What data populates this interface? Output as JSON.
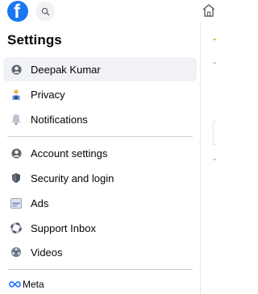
{
  "header": {
    "logo_icon": "facebook-logo-icon",
    "logo_text": "f",
    "search_icon": "search-icon",
    "home_icon": "home-icon"
  },
  "sidebar": {
    "title": "Settings",
    "profile_items": [
      {
        "label": "Deepak Kumar",
        "icon": "profile-icon",
        "active": true
      },
      {
        "label": "Privacy",
        "icon": "lock-person-icon",
        "active": false
      },
      {
        "label": "Notifications",
        "icon": "bell-icon",
        "active": false
      }
    ],
    "settings_items": [
      {
        "label": "Account settings",
        "icon": "account-icon"
      },
      {
        "label": "Security and login",
        "icon": "shield-icon"
      },
      {
        "label": "Ads",
        "icon": "ads-icon"
      },
      {
        "label": "Support Inbox",
        "icon": "lifebuoy-icon"
      },
      {
        "label": "Videos",
        "icon": "film-icon"
      }
    ],
    "footer_brand": "Meta"
  },
  "colors": {
    "brand": "#1877f2",
    "active_bg": "#f0f2f5",
    "divider": "#ced0d4"
  }
}
